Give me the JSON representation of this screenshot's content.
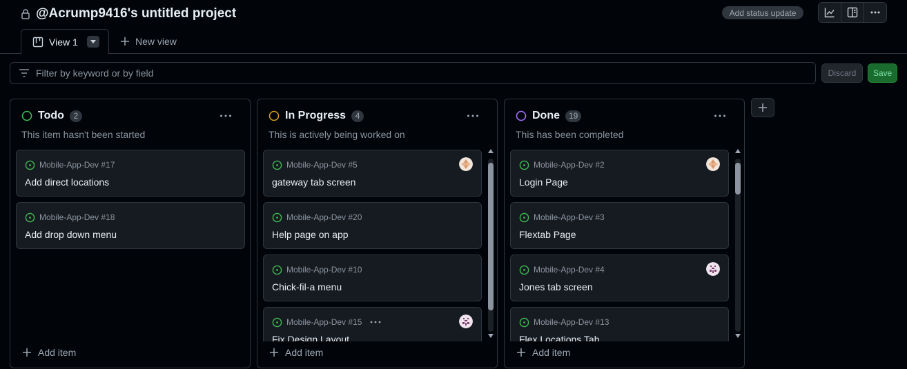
{
  "header": {
    "title": "@Acrump9416's untitled project",
    "status_update_label": "Add status update",
    "buttons": [
      "insights-icon",
      "side-panel-icon",
      "more-icon"
    ]
  },
  "tabs": {
    "active": {
      "label": "View 1"
    },
    "new_view_label": "New view"
  },
  "filter": {
    "placeholder": "Filter by keyword or by field",
    "value": "",
    "discard_label": "Discard",
    "save_label": "Save"
  },
  "columns": [
    {
      "title": "Todo",
      "count": "2",
      "description": "This item hasn't been started",
      "status_color": "#3fb950",
      "add_item_label": "Add item",
      "cards": [
        {
          "ref": "Mobile-App-Dev #17",
          "title": "Add direct locations"
        },
        {
          "ref": "Mobile-App-Dev #18",
          "title": "Add drop down menu"
        }
      ]
    },
    {
      "title": "In Progress",
      "count": "4",
      "description": "This is actively being worked on",
      "status_color": "#d29922",
      "add_item_label": "Add item",
      "cards": [
        {
          "ref": "Mobile-App-Dev #5",
          "title": "gateway tab screen"
        },
        {
          "ref": "Mobile-App-Dev #20",
          "title": "Help page on app"
        },
        {
          "ref": "Mobile-App-Dev #10",
          "title": "Chick-fil-a menu"
        },
        {
          "ref": "Mobile-App-Dev #15",
          "title": "Fix Design Layout"
        }
      ]
    },
    {
      "title": "Done",
      "count": "19",
      "description": "This has been completed",
      "status_color": "#a371f7",
      "add_item_label": "Add item",
      "cards": [
        {
          "ref": "Mobile-App-Dev #2",
          "title": "Login Page"
        },
        {
          "ref": "Mobile-App-Dev #3",
          "title": "Flextab Page"
        },
        {
          "ref": "Mobile-App-Dev #4",
          "title": "Jones tab screen"
        },
        {
          "ref": "Mobile-App-Dev #13",
          "title": "Flex Locations Tab"
        }
      ]
    }
  ],
  "colors": {
    "background": "#010409",
    "card": "#161b22",
    "border": "#30363d",
    "issue_open": "#3fb950",
    "save_green": "#196c2e"
  }
}
